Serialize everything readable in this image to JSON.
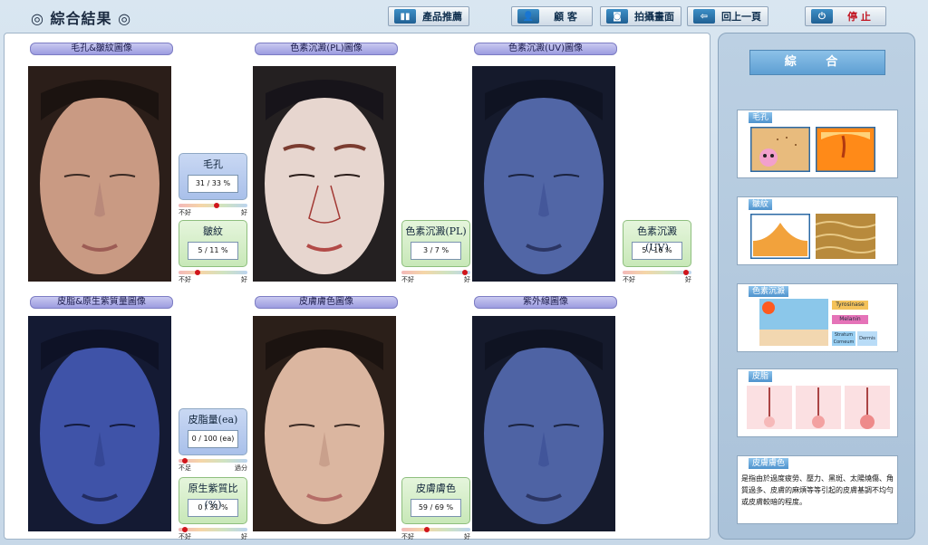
{
  "header": {
    "title": "◎ 綜合結果 ◎",
    "buttons": [
      {
        "label": "產品推薦",
        "icon": "product-icon"
      },
      {
        "label": "顧  客",
        "icon": "customer-icon"
      },
      {
        "label": "拍攝畫面",
        "icon": "camera-icon"
      },
      {
        "label": "回上一頁",
        "icon": "back-arrow-icon"
      },
      {
        "label": "停  止",
        "icon": "power-icon"
      }
    ]
  },
  "images": {
    "pore": "毛孔&皺紋圖像",
    "pl": "色素沉澱(PL)圖像",
    "uv": "色素沉澱(UV)圖像",
    "sebum": "皮脂&原生紫質量圖像",
    "tone": "皮膚膚色圖像",
    "ultraviolet": "紫外線圖像"
  },
  "metrics": {
    "pore": {
      "name": "毛孔",
      "value": "31 / 33 %",
      "level": 0.55,
      "lo": "不好",
      "hi": "好"
    },
    "wrinkle": {
      "name": "皺紋",
      "value": "5 / 11 %",
      "level": 0.25,
      "lo": "不好",
      "hi": "好"
    },
    "pigment_pl": {
      "name": "色素沉澱(PL)",
      "value": "3 / 7 %",
      "level": 0.95,
      "lo": "不好",
      "hi": "好"
    },
    "pigment_uv": {
      "name": "色素沉澱(UV)",
      "value": "5 / 16 %",
      "level": 0.95,
      "lo": "不好",
      "hi": "好"
    },
    "sebum": {
      "name": "皮脂量(ea)",
      "value": "0 / 100 (ea)",
      "level": 0.05,
      "lo": "不足",
      "hi": "過分"
    },
    "porphyrin": {
      "name": "原生紫質比(%)",
      "value": "0 / 31 %",
      "level": 0.05,
      "lo": "不好",
      "hi": "好"
    },
    "skin_tone": {
      "name": "皮膚膚色",
      "value": "59 / 69 %",
      "level": 0.35,
      "lo": "不好",
      "hi": "好"
    }
  },
  "side": {
    "summary": "綜 合",
    "cards": [
      "毛孔",
      "皺紋",
      "色素沉澱",
      "皮脂",
      "皮膚膚色"
    ],
    "pigment_labels": {
      "tyrosinase": "Tyrosinase",
      "melanin": "Melanin",
      "stratum": "Stratum Corneum",
      "dermis": "Dermis"
    },
    "note": "是指由於過度疲勞、壓力、黑斑、太陽燒傷、角質過多、皮膚的麻煩等等引起的皮膚基調不均勻或皮膚較暗的程度。"
  },
  "colors": {
    "accent": "#4f93cd",
    "indicator": "#d0151b"
  }
}
